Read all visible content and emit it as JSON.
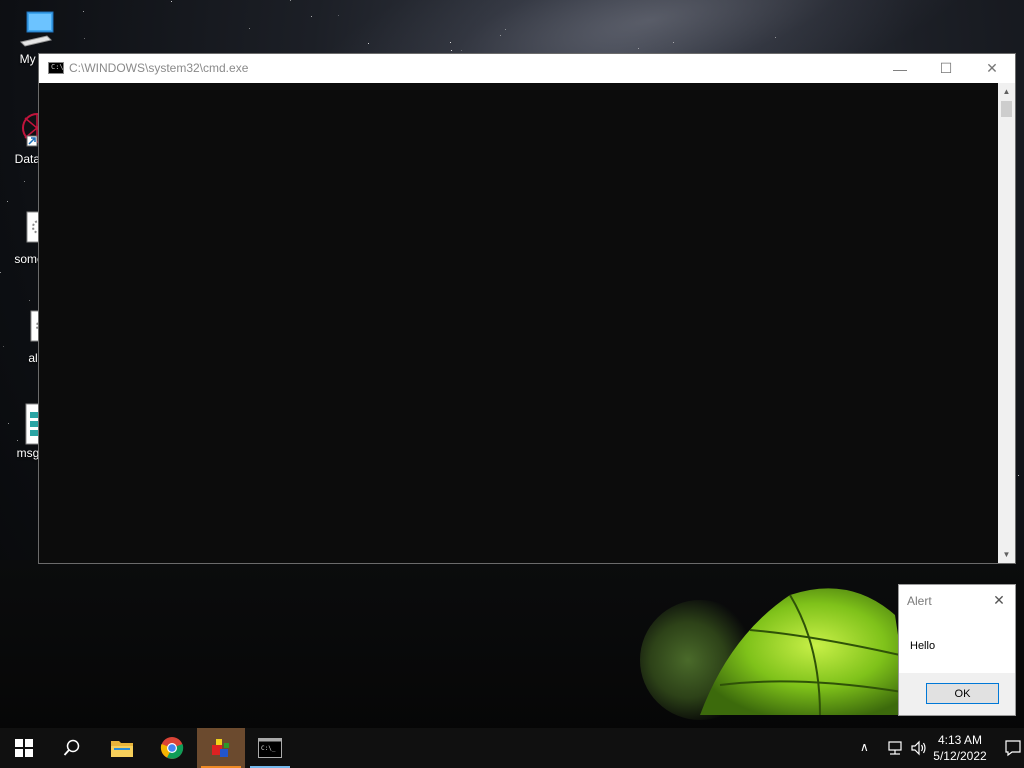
{
  "desktop": {
    "icons": [
      {
        "label": "My Co"
      },
      {
        "label": "DataW"
      },
      {
        "label": "some"
      },
      {
        "label": "al"
      },
      {
        "label": "msg"
      }
    ]
  },
  "cmd_window": {
    "title": "C:\\WINDOWS\\system32\\cmd.exe",
    "icon_text": "C:\\",
    "minimize_glyph": "—",
    "maximize_glyph": "☐",
    "close_glyph": "✕"
  },
  "alert": {
    "title": "Alert",
    "message": "Hello",
    "ok_label": "OK",
    "close_glyph": "✕"
  },
  "taskbar": {
    "clock_time": "4:13 AM",
    "clock_date": "5/12/2022",
    "tray_chevron": "∧"
  },
  "colors": {
    "accent": "#0078d7",
    "taskbar": "#101010",
    "console_bg": "#0c0c0c"
  }
}
